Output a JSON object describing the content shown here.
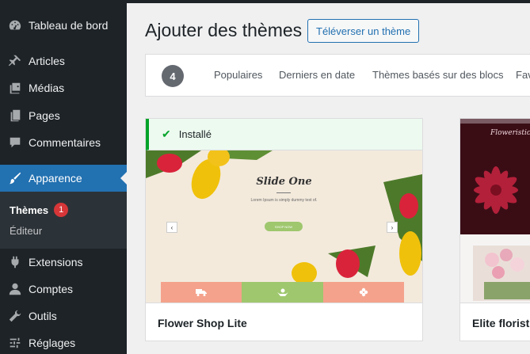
{
  "sidebar": {
    "items": [
      {
        "label": "Tableau de bord",
        "icon": "dashboard-icon"
      },
      {
        "label": "Articles",
        "icon": "pin-icon"
      },
      {
        "label": "Médias",
        "icon": "media-icon"
      },
      {
        "label": "Pages",
        "icon": "pages-icon"
      },
      {
        "label": "Commentaires",
        "icon": "comment-icon"
      },
      {
        "label": "Apparence",
        "icon": "brush-icon",
        "active": true
      },
      {
        "label": "Extensions",
        "icon": "plugin-icon"
      },
      {
        "label": "Comptes",
        "icon": "user-icon"
      },
      {
        "label": "Outils",
        "icon": "wrench-icon"
      },
      {
        "label": "Réglages",
        "icon": "settings-icon"
      }
    ],
    "submenu": [
      {
        "label": "Thèmes",
        "badge": "1",
        "current": true
      },
      {
        "label": "Éditeur"
      }
    ]
  },
  "header": {
    "title": "Ajouter des thèmes",
    "upload_label": "Téléverser un thème"
  },
  "filters": {
    "count": "4",
    "links": [
      "Populaires",
      "Derniers en date",
      "Thèmes basés sur des blocs",
      "Fav"
    ]
  },
  "themes": [
    {
      "name": "Flower Shop Lite",
      "notice": "Installé",
      "slide_title": "Slide One",
      "slide_subtitle": "Lorem Ipsum is simply dummy text of.",
      "slide_button": "SHOP NOW",
      "prev_arrow": "‹",
      "next_arrow": "›",
      "band_icons": [
        "truck-icon",
        "hands-icon",
        "flower-icon"
      ],
      "band_colors": [
        "#f4a28c",
        "#9fc76e",
        "#f4a28c"
      ]
    },
    {
      "name": "Elite florist",
      "logo_text": "Floweristic"
    }
  ],
  "colors": {
    "sidebar_bg": "#1d2327",
    "accent": "#2271b1",
    "badge": "#d63638",
    "installed": "#00a32a"
  }
}
